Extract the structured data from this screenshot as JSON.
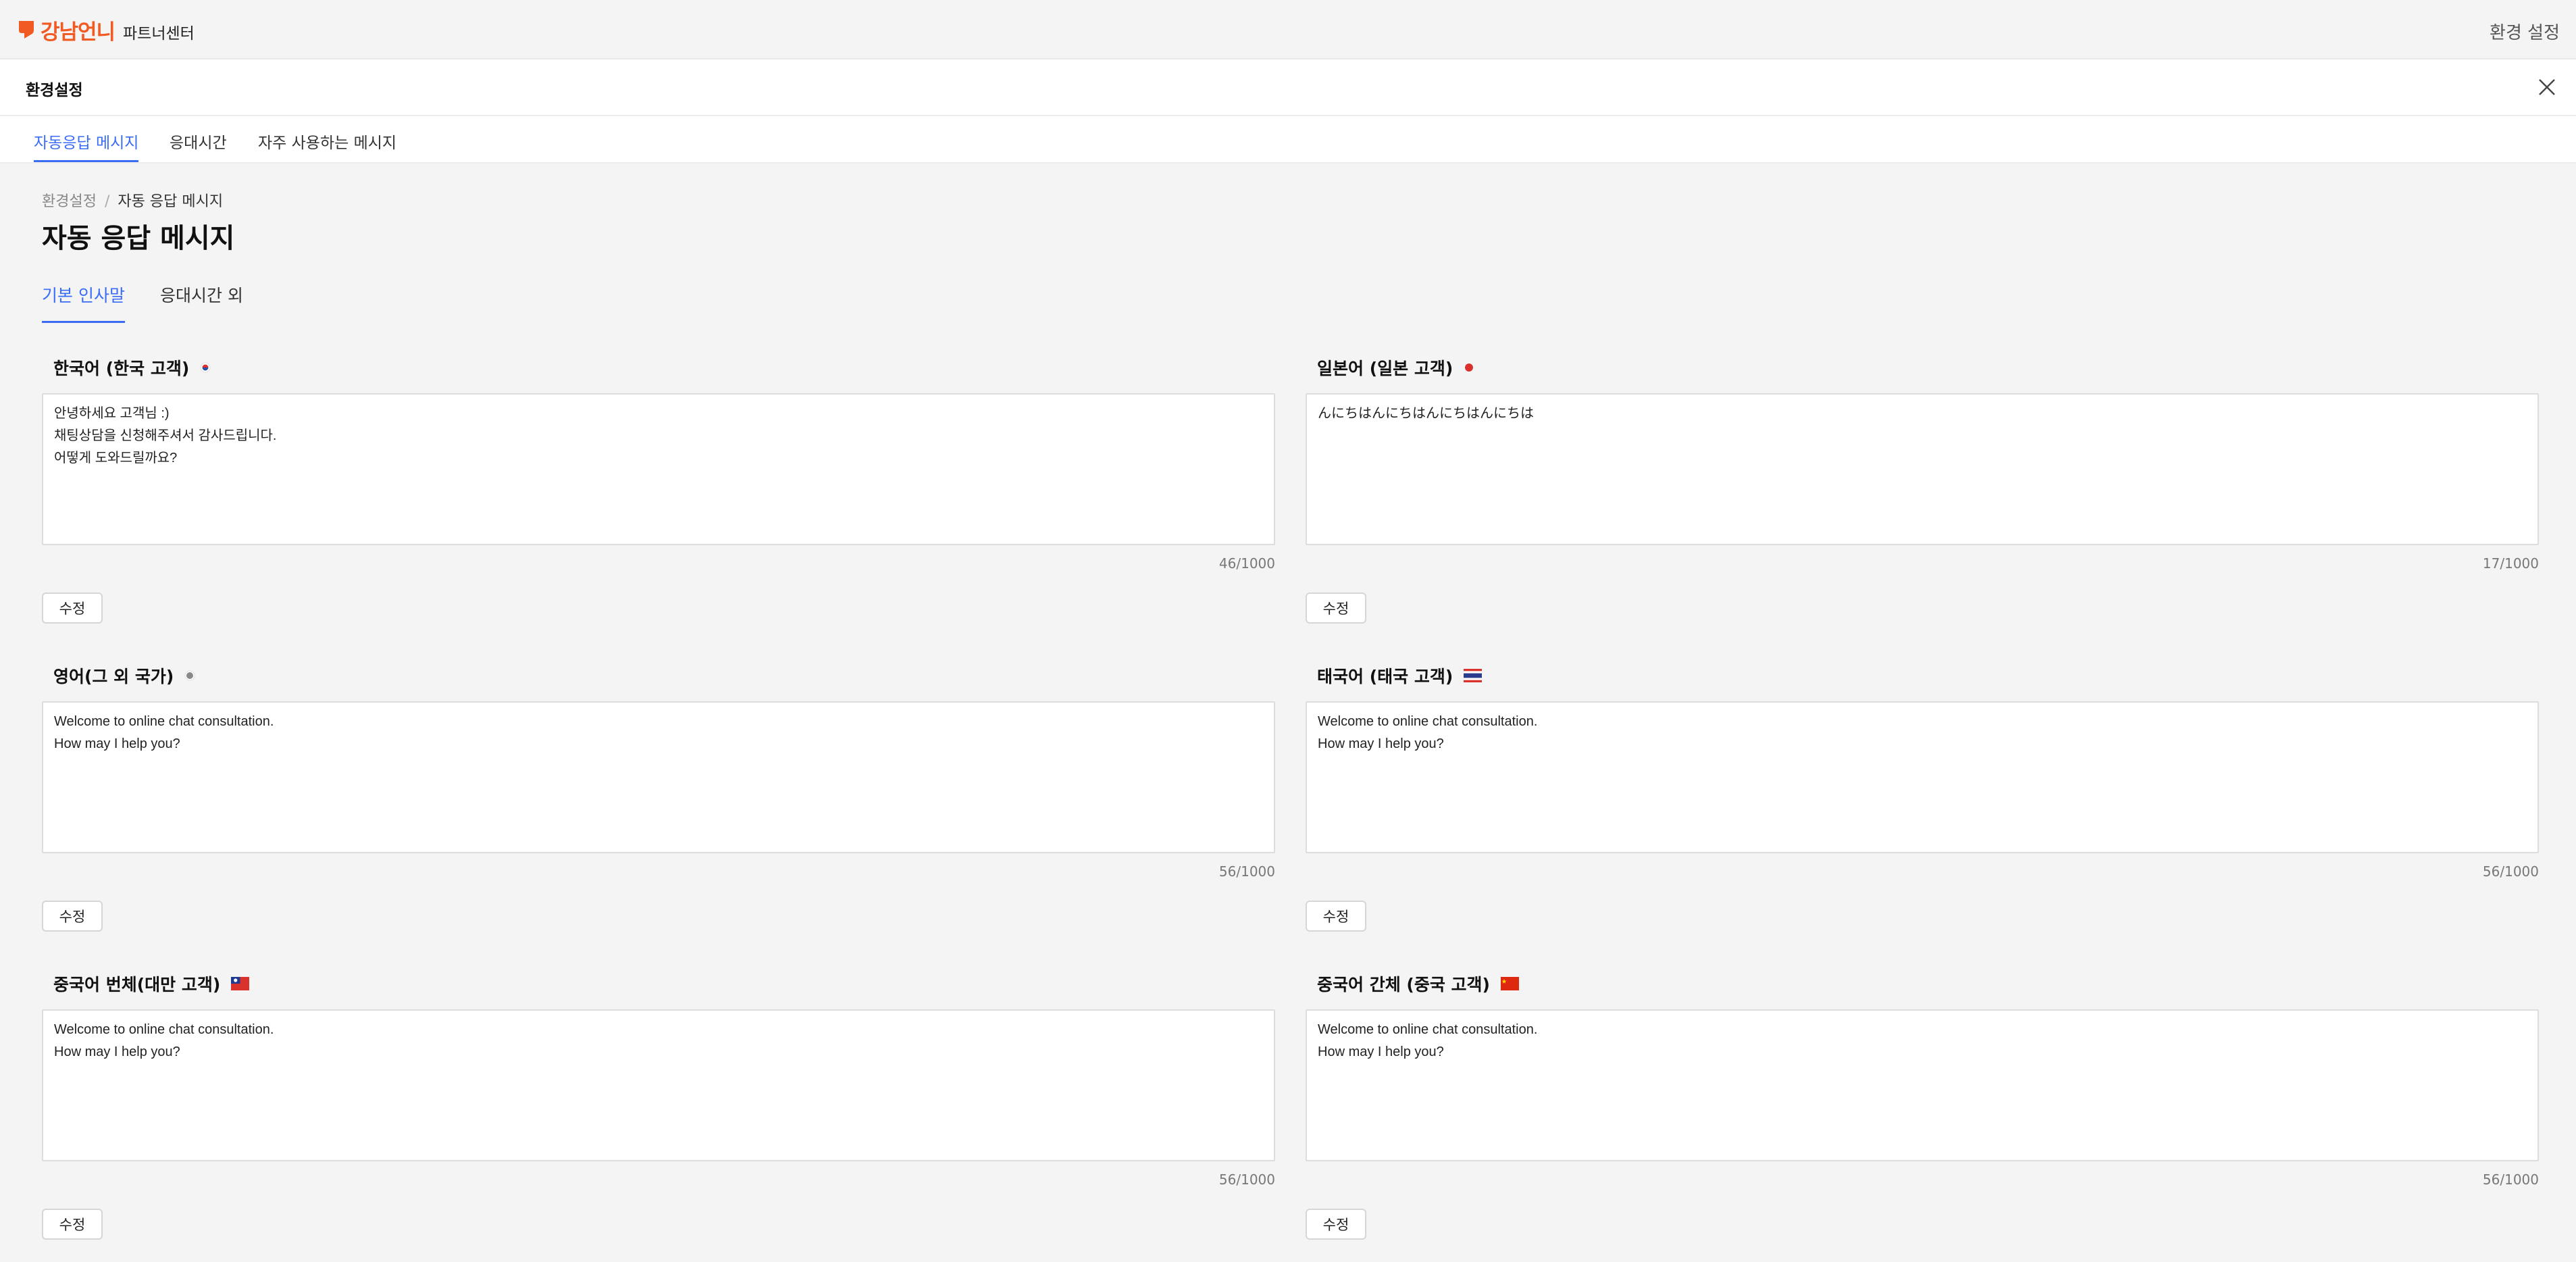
{
  "topbar": {
    "logo_text": "강남언니",
    "partner_center": "파트너센터",
    "env_settings_link": "환경 설정",
    "brand_color": "#f15a22"
  },
  "settings": {
    "title": "환경설정"
  },
  "top_tabs": [
    {
      "label": "자동응답 메시지",
      "active": true
    },
    {
      "label": "응대시간",
      "active": false
    },
    {
      "label": "자주 사용하는 메시지",
      "active": false
    }
  ],
  "breadcrumb": {
    "parent": "환경설정",
    "separator": "/",
    "current": "자동 응답 메시지"
  },
  "page_title": "자동 응답 메시지",
  "sub_tabs": [
    {
      "label": "기본 인사말",
      "active": true
    },
    {
      "label": "응대시간 외",
      "active": false
    }
  ],
  "accent_color": "#3a6cf6",
  "edit_label": "수정",
  "messages": [
    {
      "label": "한국어 (한국 고객)",
      "flag": "korea-flag-icon",
      "text": "안녕하세요 고객님 :)\n채팅상담을 신청해주셔서 감사드립니다.\n어떻게 도와드릴까요?",
      "counter": "46/1000"
    },
    {
      "label": "일본어 (일본 고객)",
      "flag": "japan-flag-icon",
      "text": "んにちはんにちはんにちはんにちは",
      "counter": "17/1000"
    },
    {
      "label": "영어(그 외 국가)",
      "flag": "globe-dot-icon",
      "text": "Welcome to online chat consultation.\nHow may I help you?",
      "counter": "56/1000"
    },
    {
      "label": "태국어 (태국 고객)",
      "flag": "thailand-flag-icon",
      "text": "Welcome to online chat consultation.\nHow may I help you?",
      "counter": "56/1000"
    },
    {
      "label": "중국어 번체(대만 고객)",
      "flag": "taiwan-flag-icon",
      "text": "Welcome to online chat consultation.\nHow may I help you?",
      "counter": "56/1000"
    },
    {
      "label": "중국어 간체 (중국 고객)",
      "flag": "china-flag-icon",
      "text": "Welcome to online chat consultation.\nHow may I help you?",
      "counter": "56/1000"
    }
  ]
}
